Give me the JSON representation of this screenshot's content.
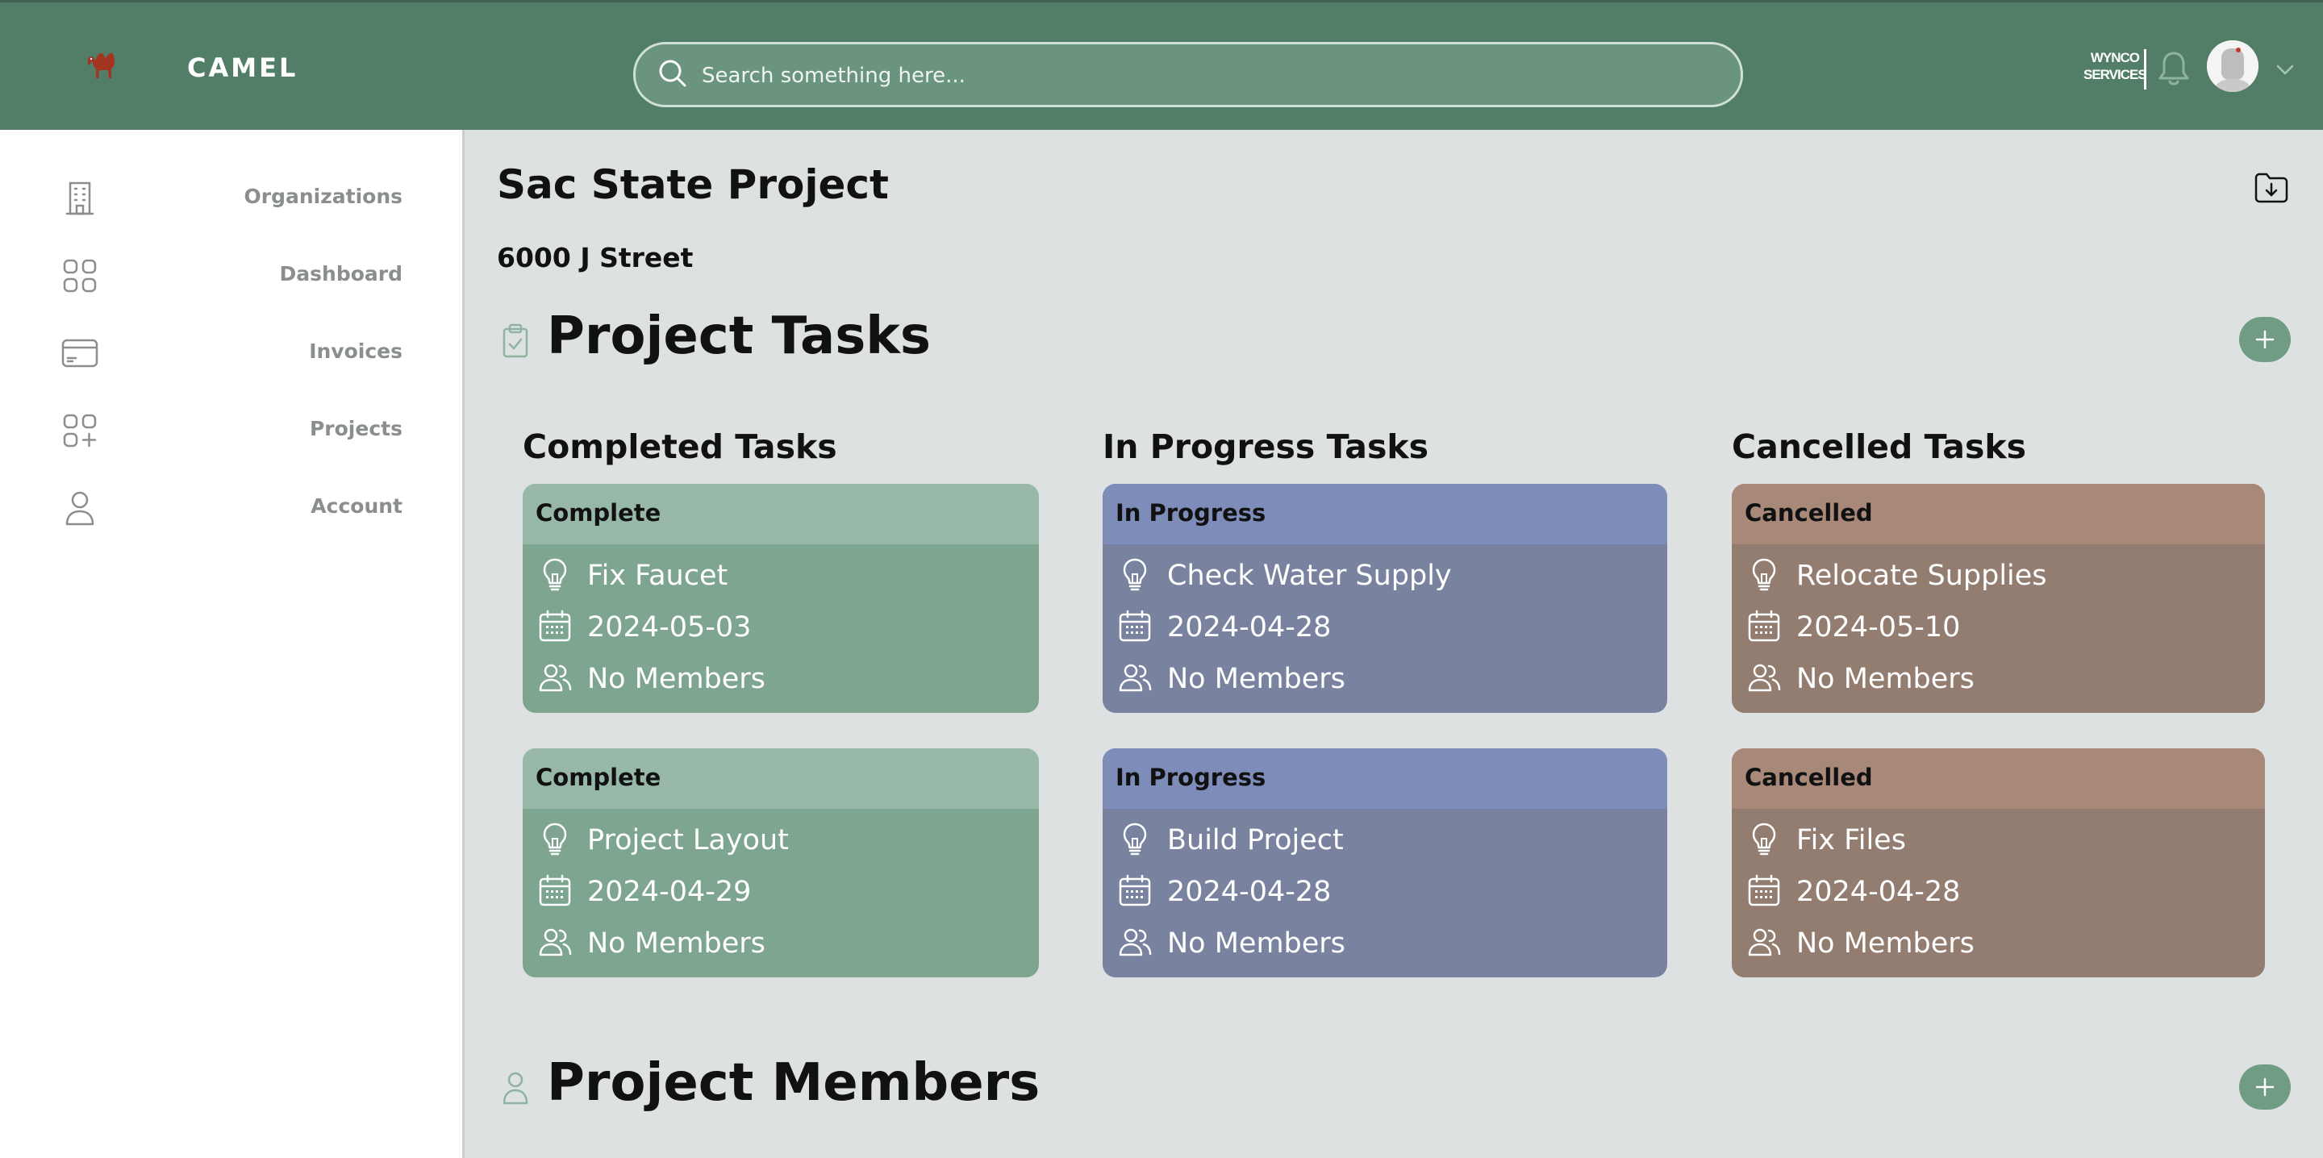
{
  "header": {
    "brand": "CAMEL",
    "search_placeholder": "Search something here...",
    "company_logo_line1": "WYNCO",
    "company_logo_line2": "SERVICES",
    "icons": [
      "camel-logo-icon",
      "search-icon",
      "bell-icon",
      "avatar",
      "chevron-down-icon"
    ]
  },
  "sidebar": {
    "items": [
      {
        "label": "Organizations",
        "icon": "building-icon"
      },
      {
        "label": "Dashboard",
        "icon": "grid-icon"
      },
      {
        "label": "Invoices",
        "icon": "card-icon"
      },
      {
        "label": "Projects",
        "icon": "grid-plus-icon"
      },
      {
        "label": "Account",
        "icon": "user-icon"
      }
    ]
  },
  "project": {
    "title": "Sac State Project",
    "address": "6000 J Street"
  },
  "tasks_section": {
    "title": "Project Tasks",
    "columns": [
      {
        "title": "Completed Tasks",
        "cards": [
          {
            "status": "Complete",
            "name": "Fix Faucet",
            "date": "2024-05-03",
            "members": "No Members"
          },
          {
            "status": "Complete",
            "name": "Project Layout",
            "date": "2024-04-29",
            "members": "No Members"
          }
        ]
      },
      {
        "title": "In Progress Tasks",
        "cards": [
          {
            "status": "In Progress",
            "name": "Check Water Supply",
            "date": "2024-04-28",
            "members": "No Members"
          },
          {
            "status": "In Progress",
            "name": "Build Project",
            "date": "2024-04-28",
            "members": "No Members"
          }
        ]
      },
      {
        "title": "Cancelled Tasks",
        "cards": [
          {
            "status": "Cancelled",
            "name": "Relocate Supplies",
            "date": "2024-05-10",
            "members": "No Members"
          },
          {
            "status": "Cancelled",
            "name": "Fix Files",
            "date": "2024-04-28",
            "members": "No Members"
          }
        ]
      }
    ]
  },
  "members_section": {
    "title": "Project Members"
  },
  "colors": {
    "header": "#527e68",
    "complete": "#7ea590",
    "in_progress": "#79839f",
    "cancelled": "#937c70",
    "accent_button": "#6f9c83"
  }
}
